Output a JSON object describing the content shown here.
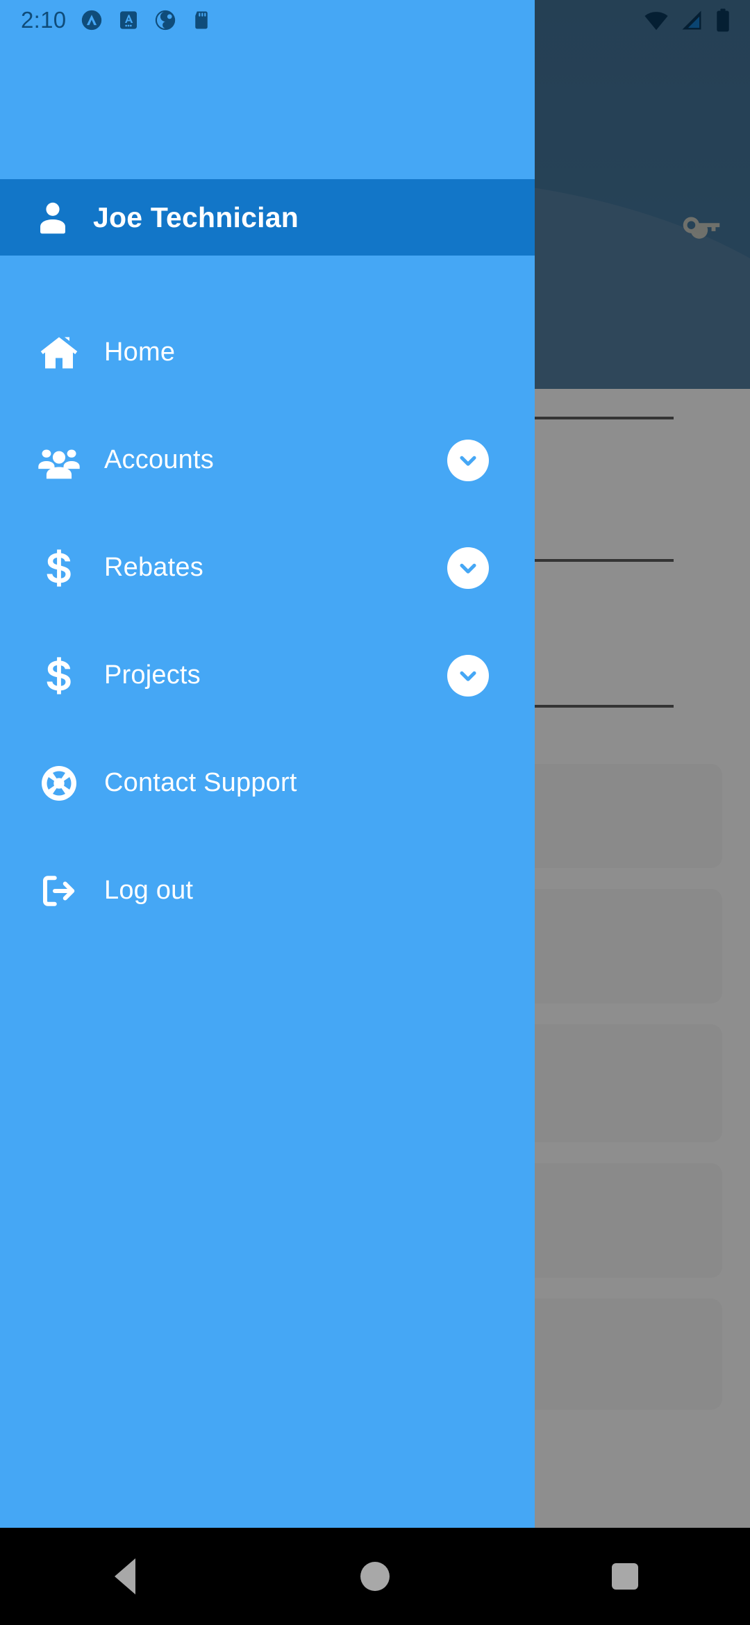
{
  "status_bar": {
    "clock": "2:10",
    "notification_icons": [
      "circled-caret-icon",
      "letter-a-badge-icon",
      "circle-dot-icon",
      "sd-card-icon"
    ],
    "system_icons": [
      "wifi-icon",
      "cellular-signal-icon",
      "battery-icon"
    ],
    "text_color": "#0f4c7a"
  },
  "drawer": {
    "background_color": "#45a7f5",
    "header": {
      "user_name": "Joe Technician",
      "avatar_icon": "person-icon",
      "background_color": "#1276c8"
    },
    "menu_items": [
      {
        "label": "Home",
        "icon": "home-icon",
        "expandable": false,
        "chevron_icon": ""
      },
      {
        "label": "Accounts",
        "icon": "group-people-icon",
        "expandable": true,
        "chevron_icon": "chevron-down-icon"
      },
      {
        "label": "Rebates",
        "icon": "dollar-sign-icon",
        "expandable": true,
        "chevron_icon": "chevron-down-icon"
      },
      {
        "label": "Projects",
        "icon": "dollar-sign-icon",
        "expandable": true,
        "chevron_icon": "chevron-down-icon"
      },
      {
        "label": "Contact Support",
        "icon": "life-ring-icon",
        "expandable": false,
        "chevron_icon": ""
      },
      {
        "label": "Log out",
        "icon": "logout-icon",
        "expandable": false,
        "chevron_icon": ""
      }
    ]
  },
  "background_app": {
    "hero_color": "#0b4572",
    "wave_color": "#1f557f",
    "key_icon": "key-icon",
    "content_background": "#f2f2f2",
    "scrim_color": "rgba(60,60,60,0.55)"
  },
  "system_nav": {
    "buttons": [
      {
        "name": "back",
        "icon": "triangle-back-icon"
      },
      {
        "name": "home",
        "icon": "circle-home-icon"
      },
      {
        "name": "recents",
        "icon": "square-recents-icon"
      }
    ],
    "background_color": "#000000"
  }
}
